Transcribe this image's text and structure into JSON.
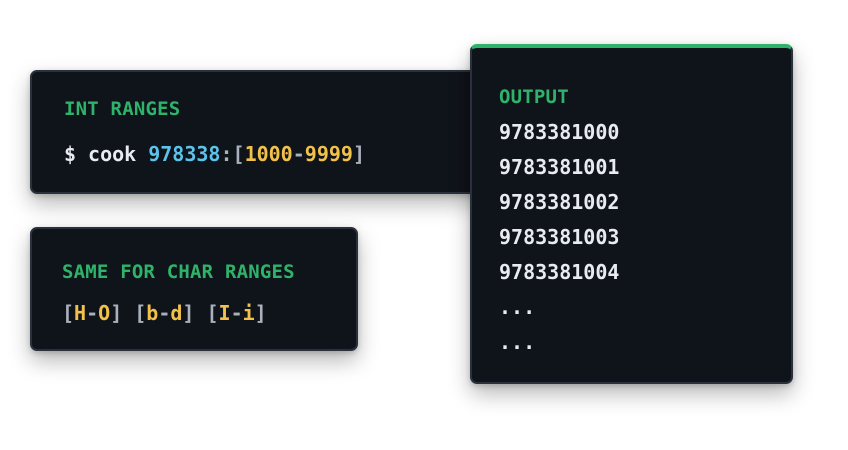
{
  "int_ranges": {
    "heading": "INT RANGES",
    "prompt": "$",
    "command": "cook",
    "prefix": "978338",
    "colon": ":",
    "open_bracket": "[",
    "range_start": "1000",
    "dash": "-",
    "range_end": "9999",
    "close_bracket": "]"
  },
  "char_ranges": {
    "heading": "SAME FOR CHAR RANGES",
    "ranges": [
      {
        "open": "[",
        "start": "H",
        "dash": "-",
        "end": "O",
        "close": "]"
      },
      {
        "open": "[",
        "start": "b",
        "dash": "-",
        "end": "d",
        "close": "]"
      },
      {
        "open": "[",
        "start": "I",
        "dash": "-",
        "end": "i",
        "close": "]"
      }
    ]
  },
  "output": {
    "heading": "OUTPUT",
    "lines": [
      "9783381000",
      "9783381001",
      "9783381002",
      "9783381003",
      "9783381004",
      "...",
      "..."
    ]
  },
  "colors": {
    "accent_green": "#2fb36a",
    "number_blue": "#5cc3ea",
    "range_yellow": "#f2c14a",
    "card_background": "#0f131a"
  }
}
